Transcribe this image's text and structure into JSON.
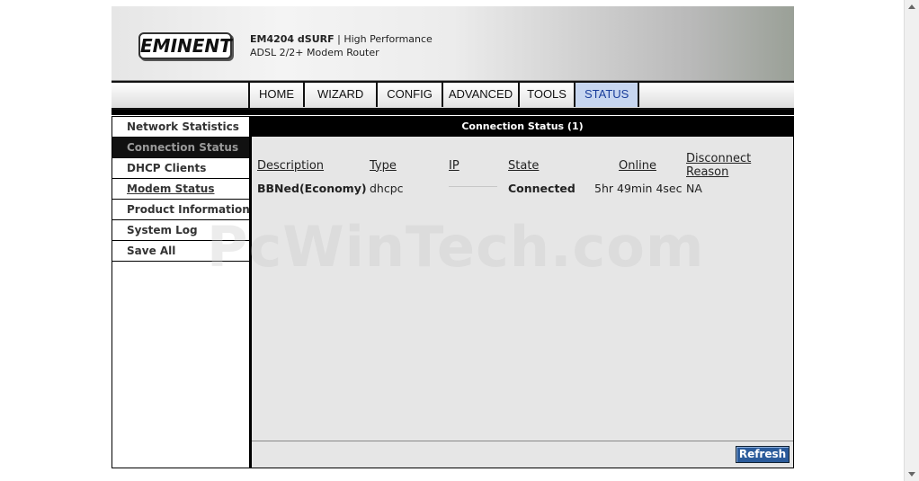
{
  "header": {
    "logo": "EMINENT",
    "model": "EM4204 dSURF",
    "tagline_1": "| High Performance",
    "tagline_2": "ADSL 2/2+ Modem Router"
  },
  "nav": {
    "tabs": [
      "HOME",
      "WIZARD",
      "CONFIG",
      "ADVANCED",
      "TOOLS",
      "STATUS"
    ],
    "active": "STATUS"
  },
  "sidebar": {
    "items": [
      {
        "label": "Network Statistics"
      },
      {
        "label": "Connection Status"
      },
      {
        "label": "DHCP Clients"
      },
      {
        "label": "Modem Status"
      },
      {
        "label": "Product Information"
      },
      {
        "label": "System Log"
      },
      {
        "label": "Save All"
      }
    ],
    "active": "Connection Status"
  },
  "content": {
    "title": "Connection Status (1)",
    "columns": [
      "Description",
      "Type",
      "IP",
      "State",
      "Online",
      "Disconnect Reason"
    ],
    "rows": [
      {
        "description": "BBNed(Economy)",
        "type": "dhcpc",
        "ip": "",
        "state": "Connected",
        "online": "5hr 49min 4sec",
        "reason": "NA"
      }
    ],
    "refresh_label": "Refresh"
  },
  "watermark": "PcWinTech.com",
  "colors": {
    "active_tab_bg": "#c7d6f0",
    "refresh_bg": "#2b5b9b",
    "panel_bg": "#e6e6e6"
  }
}
